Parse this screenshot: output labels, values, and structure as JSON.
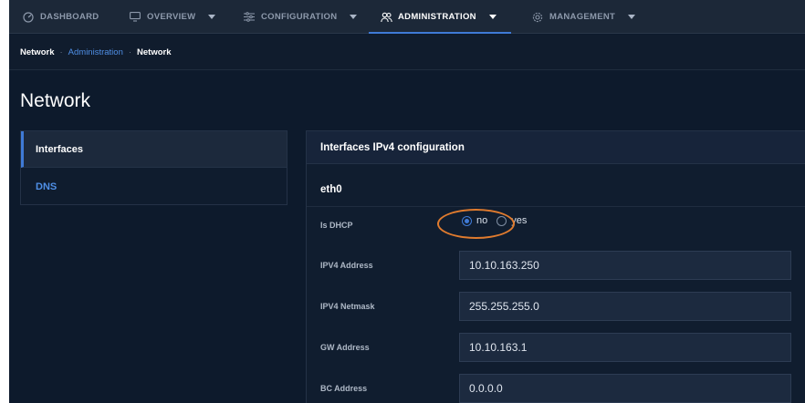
{
  "nav": {
    "items": [
      {
        "label": "DASHBOARD",
        "icon": "dashboard-icon",
        "has_caret": false
      },
      {
        "label": "OVERVIEW",
        "icon": "monitor-icon",
        "has_caret": true
      },
      {
        "label": "CONFIGURATION",
        "icon": "sliders-icon",
        "has_caret": true
      },
      {
        "label": "ADMINISTRATION",
        "icon": "users-icon",
        "has_caret": true,
        "active": true
      },
      {
        "label": "MANAGEMENT",
        "icon": "gear-icon",
        "has_caret": true
      }
    ]
  },
  "breadcrumb": {
    "items": [
      "Network",
      "Administration",
      "Network"
    ],
    "separator": "·"
  },
  "page": {
    "title": "Network"
  },
  "sidebar": {
    "items": [
      {
        "label": "Interfaces",
        "selected": true
      },
      {
        "label": "DNS",
        "selected": false
      }
    ]
  },
  "panel": {
    "header": "Interfaces IPv4 configuration",
    "interface_name": "eth0",
    "dhcp": {
      "label": "Is DHCP",
      "options": [
        "no",
        "yes"
      ],
      "selected": "no"
    },
    "fields": [
      {
        "label": "IPV4 Address",
        "value": "10.10.163.250"
      },
      {
        "label": "IPV4 Netmask",
        "value": "255.255.255.0"
      },
      {
        "label": "GW Address",
        "value": "10.10.163.1"
      },
      {
        "label": "BC Address",
        "value": "0.0.0.0"
      }
    ]
  },
  "colors": {
    "accent": "#3f7ad6",
    "link": "#4f8fe6",
    "highlight": "#e07b2e",
    "background": "#0d1a2c"
  }
}
